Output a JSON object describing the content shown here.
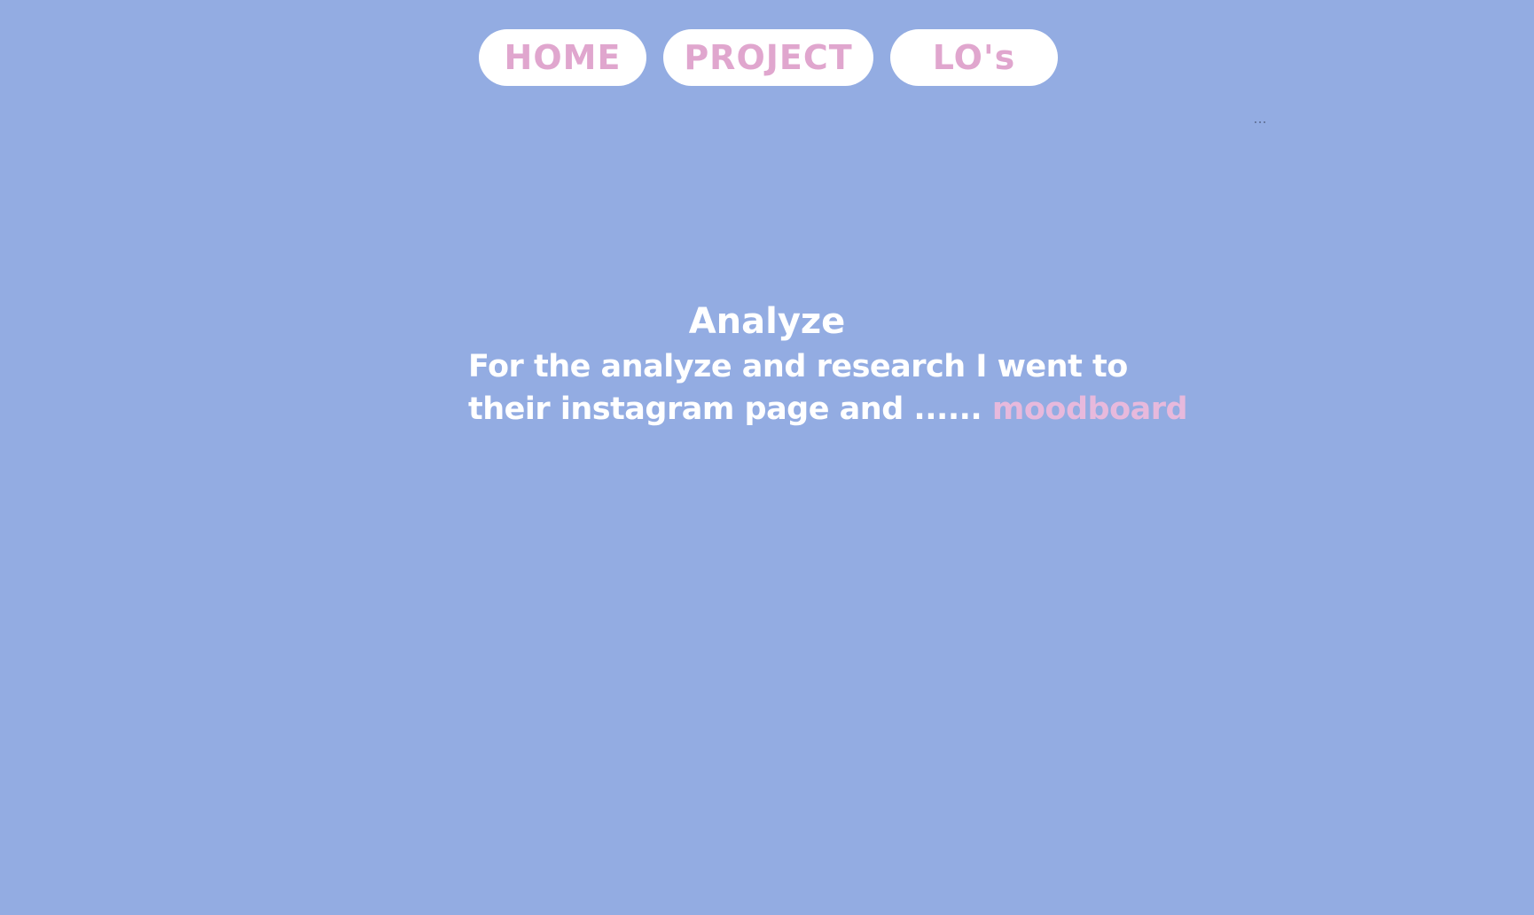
{
  "nav": {
    "home_label": "HOME",
    "project_label": "PROJECT",
    "los_label": "LO's"
  },
  "more_menu": {
    "label": "..."
  },
  "content": {
    "title": "Analyze",
    "line1": "For the analyze and research I went to",
    "line2": "their instagram page and ......",
    "link_text": "moodboard"
  },
  "colors": {
    "background": "#93ACE2",
    "nav_button_bg": "#ffffff",
    "nav_text": "#E0A6CE",
    "body_text": "#ffffff",
    "link": "#E7B9DC"
  }
}
